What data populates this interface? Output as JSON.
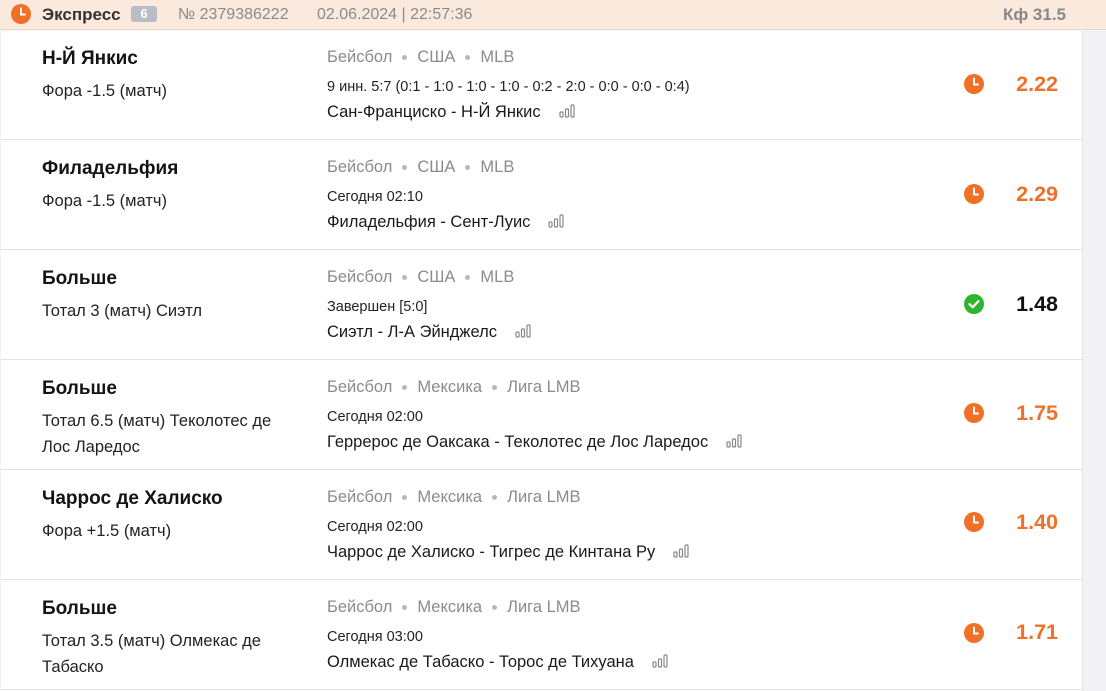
{
  "header": {
    "title": "Экспресс",
    "count": "6",
    "number": "№ 2379386222",
    "datetime": "02.06.2024 | 22:57:36",
    "coef": "Кф 31.5"
  },
  "colors": {
    "accent": "#f07028",
    "won": "#2fb42f",
    "header_bg": "#fbe9dd"
  },
  "icons": {
    "pending": "clock-icon",
    "won": "check-circle-icon",
    "stats": "stats-bars-icon"
  },
  "bets": [
    {
      "outcome": "Н-Й Янкис",
      "market": "Фора -1.5 (матч)",
      "sport": "Бейсбол",
      "country": "США",
      "league": "MLB",
      "info": "9 инн. 5:7 (0:1 - 1:0 - 1:0 - 1:0 - 0:2 - 2:0 - 0:0 - 0:0 - 0:4)",
      "teams": "Сан-Франциско - Н-Й Янкис",
      "coef": "2.22",
      "status": "pending"
    },
    {
      "outcome": "Филадельфия",
      "market": "Фора -1.5 (матч)",
      "sport": "Бейсбол",
      "country": "США",
      "league": "MLB",
      "info": "Сегодня 02:10",
      "teams": "Филадельфия - Сент-Луис",
      "coef": "2.29",
      "status": "pending"
    },
    {
      "outcome": "Больше",
      "market": "Тотал 3 (матч) Сиэтл",
      "sport": "Бейсбол",
      "country": "США",
      "league": "MLB",
      "info": "Завершен [5:0]",
      "teams": "Сиэтл - Л-А Эйнджелс",
      "coef": "1.48",
      "status": "won"
    },
    {
      "outcome": "Больше",
      "market": "Тотал 6.5 (матч) Теколотес де Лос Ларедос",
      "sport": "Бейсбол",
      "country": "Мексика",
      "league": "Лига LMB",
      "info": "Сегодня 02:00",
      "teams": "Геррерос де Оаксака - Теколотес де Лос Ларедос",
      "coef": "1.75",
      "status": "pending"
    },
    {
      "outcome": "Чаррос де Халиско",
      "market": "Фора +1.5 (матч)",
      "sport": "Бейсбол",
      "country": "Мексика",
      "league": "Лига LMB",
      "info": "Сегодня 02:00",
      "teams": "Чаррос де Халиско - Тигрес де Кинтана Ру",
      "coef": "1.40",
      "status": "pending"
    },
    {
      "outcome": "Больше",
      "market": "Тотал 3.5 (матч) Олмекас де Табаско",
      "sport": "Бейсбол",
      "country": "Мексика",
      "league": "Лига LMB",
      "info": "Сегодня 03:00",
      "teams": "Олмекас де Табаско - Торос де Тихуана",
      "coef": "1.71",
      "status": "pending"
    }
  ]
}
